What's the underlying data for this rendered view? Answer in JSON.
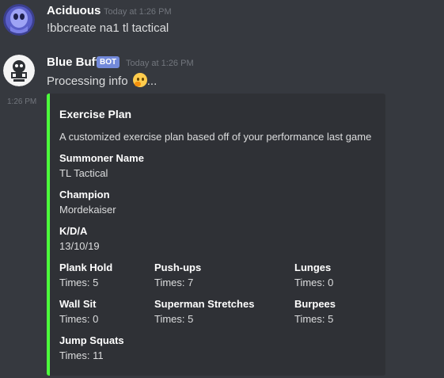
{
  "colors": {
    "background": "#36393f",
    "embed_background": "#2f3136",
    "embed_accent": "#4cff3c",
    "bot_badge": "#7289da"
  },
  "messages": [
    {
      "author": "Aciduous",
      "timestamp": "Today at 1:26 PM",
      "text": "!bbcreate na1 tl tactical",
      "avatar_icon": "ghost-avatar-icon"
    },
    {
      "author": "Blue Buff",
      "badge": "BOT",
      "timestamp": "Today at 1:26 PM",
      "text": "Processing info",
      "text_suffix": "...",
      "emoji": "thinking-face-icon",
      "avatar_icon": "bot-avatar-icon"
    }
  ],
  "side_timestamp": "1:26 PM",
  "embed": {
    "title": "Exercise Plan",
    "description": "A customized exercise plan based off of your performance last game",
    "fields": [
      {
        "name": "Summoner Name",
        "value": "TL Tactical"
      },
      {
        "name": "Champion",
        "value": "Mordekaiser"
      },
      {
        "name": "K/D/A",
        "value": "13/10/19"
      },
      {
        "name": "Plank Hold",
        "value": "Times: 5"
      },
      {
        "name": "Push-ups",
        "value": "Times: 7"
      },
      {
        "name": "Lunges",
        "value": "Times: 0"
      },
      {
        "name": "Wall Sit",
        "value": "Times: 0"
      },
      {
        "name": "Superman Stretches",
        "value": "Times: 5"
      },
      {
        "name": "Burpees",
        "value": "Times: 5"
      },
      {
        "name": "Jump Squats",
        "value": "Times: 11"
      }
    ]
  }
}
